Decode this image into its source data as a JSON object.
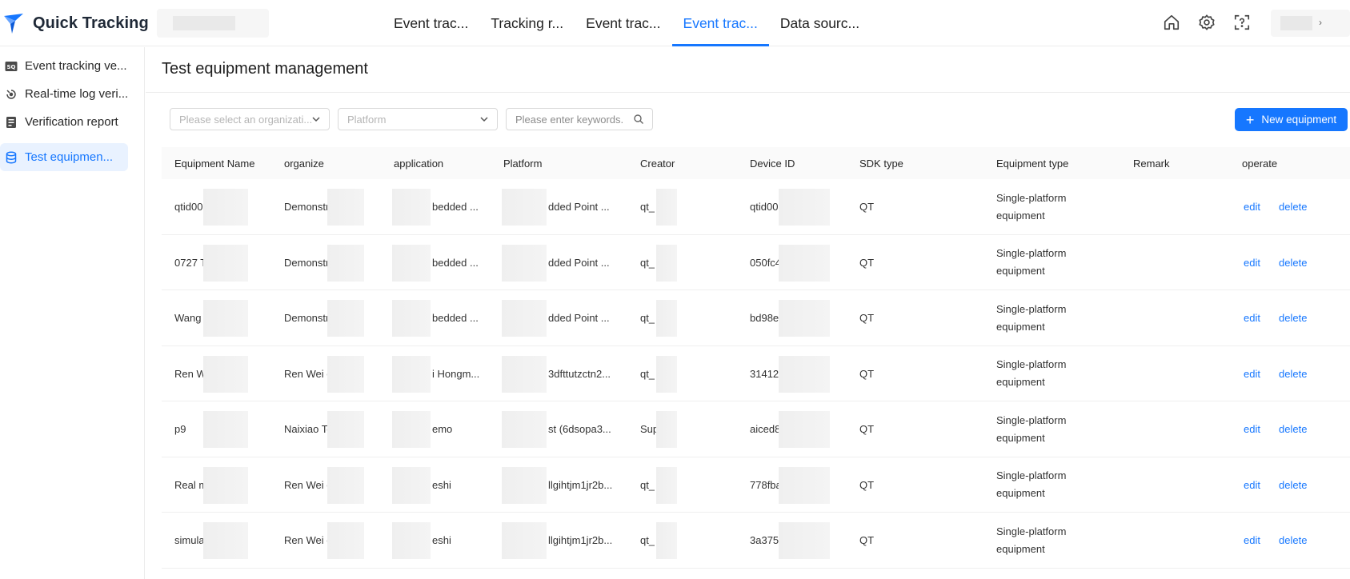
{
  "app": {
    "name": "Quick Tracking"
  },
  "colors": {
    "accent": "#1677ff",
    "active_bg": "#e9f2ff"
  },
  "nav": {
    "tabs": [
      {
        "label": "Event trac..."
      },
      {
        "label": "Tracking r..."
      },
      {
        "label": "Event trac..."
      },
      {
        "label": "Event trac...",
        "active": true
      },
      {
        "label": "Data sourc..."
      }
    ]
  },
  "header_icons": [
    "home-icon",
    "settings-icon",
    "help-icon"
  ],
  "sidebar": {
    "items": [
      {
        "label": "Event tracking ve...",
        "icon": "verification-icon"
      },
      {
        "label": "Real-time log veri...",
        "icon": "realtime-icon"
      },
      {
        "label": "Verification report",
        "icon": "report-icon"
      },
      {
        "label": "Test equipmen...",
        "icon": "database-icon",
        "active": true
      }
    ]
  },
  "page": {
    "title": "Test equipment management"
  },
  "filters": {
    "organization_placeholder": "Please select an organizati...",
    "platform_placeholder": "Platform",
    "keyword_placeholder": "Please enter keywords."
  },
  "actions": {
    "new_equipment": "New equipment"
  },
  "table": {
    "columns": [
      "Equipment Name",
      "organize",
      "application",
      "Platform",
      "Creator",
      "Device ID",
      "SDK type",
      "Equipment type",
      "Remark",
      "operate"
    ],
    "rows": [
      {
        "name": "qtid00",
        "organize": "Demonstra",
        "application": "bedded ...",
        "platform": "dded Point ...",
        "creator": "qt_",
        "device_id": "qtid00",
        "sdk": "QT",
        "type": "Single-platform equipment",
        "remark": "",
        "edit": "edit",
        "delete": "delete"
      },
      {
        "name": "0727 T",
        "organize": "Demonstra",
        "application": "bedded ...",
        "platform": "dded Point ...",
        "creator": "qt_",
        "device_id": "050fc4",
        "sdk": "QT",
        "type": "Single-platform equipment",
        "remark": "",
        "edit": "edit",
        "delete": "delete"
      },
      {
        "name": "Wang I",
        "organize": "Demonstra",
        "application": "bedded ...",
        "platform": "dded Point ...",
        "creator": "qt_",
        "device_id": "bd98e",
        "sdk": "QT",
        "type": "Single-platform equipment",
        "remark": "",
        "edit": "edit",
        "delete": "delete"
      },
      {
        "name": "Ren W",
        "organize": "Ren Wei o",
        "application": "i Hongm...",
        "platform": "3dfttutzctn2...",
        "creator": "qt_",
        "device_id": "314127",
        "sdk": "QT",
        "type": "Single-platform equipment",
        "remark": "",
        "edit": "edit",
        "delete": "delete"
      },
      {
        "name": "p9",
        "organize": "Naixiao Te",
        "application": "emo",
        "platform": "st (6dsopa3...",
        "creator": "Sup",
        "device_id": "aiced8",
        "sdk": "QT",
        "type": "Single-platform equipment",
        "remark": "",
        "edit": "edit",
        "delete": "delete"
      },
      {
        "name": "Real m",
        "organize": "Ren Wei o",
        "application": "eshi",
        "platform": "llgihtjm1jr2b...",
        "creator": "qt_",
        "device_id": "778fba",
        "sdk": "QT",
        "type": "Single-platform equipment",
        "remark": "",
        "edit": "edit",
        "delete": "delete"
      },
      {
        "name": "simulat",
        "organize": "Ren Wei o",
        "application": "eshi",
        "platform": "llgihtjm1jr2b...",
        "creator": "qt_",
        "device_id": "3a375",
        "sdk": "QT",
        "type": "Single-platform equipment",
        "remark": "",
        "edit": "edit",
        "delete": "delete"
      }
    ]
  }
}
